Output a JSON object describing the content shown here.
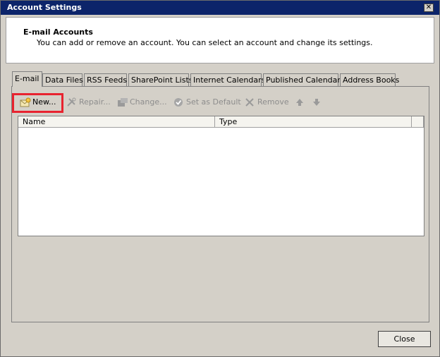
{
  "window": {
    "title": "Account Settings",
    "close_glyph": "✕"
  },
  "header": {
    "title": "E-mail Accounts",
    "subtitle": "You can add or remove an account. You can select an account and change its settings."
  },
  "tabs": [
    {
      "label": "E-mail",
      "active": true
    },
    {
      "label": "Data Files"
    },
    {
      "label": "RSS Feeds"
    },
    {
      "label": "SharePoint Lists"
    },
    {
      "label": "Internet Calendars"
    },
    {
      "label": "Published Calendars"
    },
    {
      "label": "Address Books"
    }
  ],
  "toolbar": {
    "new_label": "New...",
    "repair_label": "Repair...",
    "change_label": "Change...",
    "default_label": "Set as Default",
    "remove_label": "Remove",
    "up_icon": "up-arrow-icon",
    "down_icon": "down-arrow-icon"
  },
  "list": {
    "columns": [
      "Name",
      "Type"
    ],
    "rows": []
  },
  "footer": {
    "close_label": "Close"
  },
  "colors": {
    "titlebar": "#0c246a",
    "highlight": "#e8232f",
    "dialog_bg": "#d4d0c8"
  }
}
